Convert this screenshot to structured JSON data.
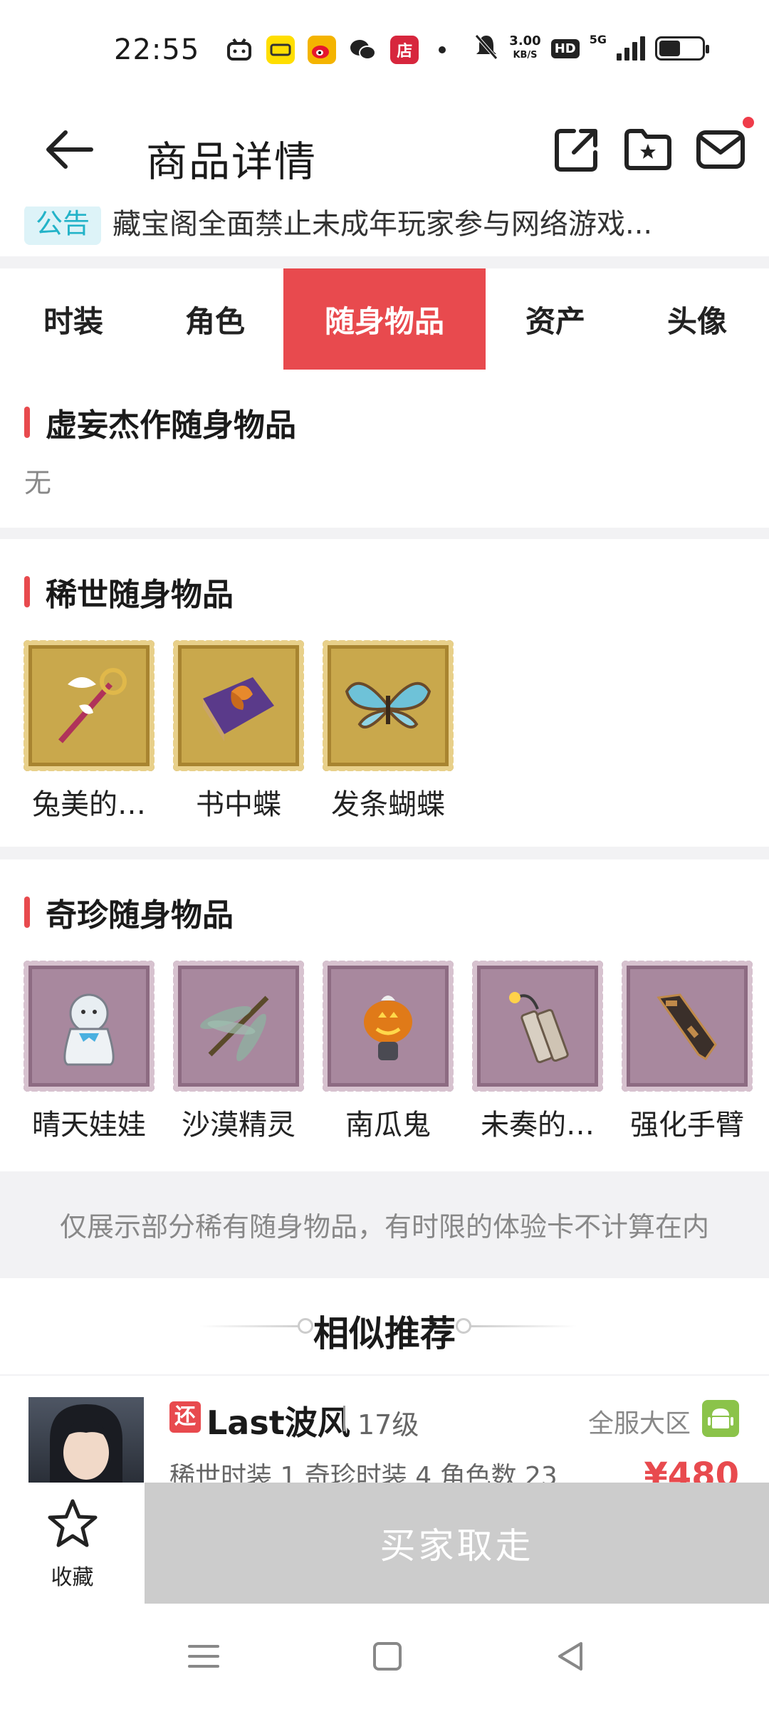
{
  "status_bar": {
    "time": "22:55",
    "speed": "3.00",
    "speed_unit": "KB/S",
    "hd": "HD",
    "network": "5G",
    "app_icons": [
      "bilibili-icon",
      "xianyu-icon",
      "weibo-icon",
      "wechat-icon",
      "shop-icon"
    ],
    "shop_label": "店"
  },
  "header": {
    "title": "商品详情",
    "icons": [
      "back-arrow-icon",
      "share-icon",
      "folder-star-icon",
      "mail-icon"
    ]
  },
  "notice": {
    "badge": "公告",
    "text": "藏宝阁全面禁止未成年玩家参与网络游戏..."
  },
  "tabs": [
    {
      "label": "时装",
      "active": false
    },
    {
      "label": "角色",
      "active": false
    },
    {
      "label": "随身物品",
      "active": true
    },
    {
      "label": "资产",
      "active": false
    },
    {
      "label": "头像",
      "active": false
    }
  ],
  "sections": {
    "masterpiece": {
      "title": "虚妄杰作随身物品",
      "empty_text": "无"
    },
    "rare": {
      "title": "稀世随身物品",
      "items": [
        {
          "name": "兔美的…",
          "icon": "wand-icon"
        },
        {
          "name": "书中蝶",
          "icon": "book-butterfly-icon"
        },
        {
          "name": "发条蝴蝶",
          "icon": "clockwork-butterfly-icon"
        }
      ]
    },
    "precious": {
      "title": "奇珍随身物品",
      "items": [
        {
          "name": "晴天娃娃",
          "icon": "teru-doll-icon"
        },
        {
          "name": "沙漠精灵",
          "icon": "dragonfly-icon"
        },
        {
          "name": "南瓜鬼",
          "icon": "pumpkin-icon"
        },
        {
          "name": "未奏的…",
          "icon": "firecracker-icon"
        },
        {
          "name": "强化手臂",
          "icon": "mech-arm-icon"
        }
      ]
    }
  },
  "disclaimer": "仅展示部分稀有随身物品，有时限的体验卡不计算在内",
  "similar": {
    "title": "相似推荐",
    "item": {
      "badge": "还",
      "name": "Last波风",
      "level": "17级",
      "server": "全服大区",
      "desc": "稀世时装 1 奇珍时装 4 角色数 23",
      "price": "¥480"
    }
  },
  "action_bar": {
    "favorite_label": "收藏",
    "buy_label": "买家取走"
  },
  "colors": {
    "accent": "#e84a4e",
    "notice_bg": "#ddf3f8",
    "notice_fg": "#23b3c8",
    "disabled_button": "#cccccc"
  }
}
